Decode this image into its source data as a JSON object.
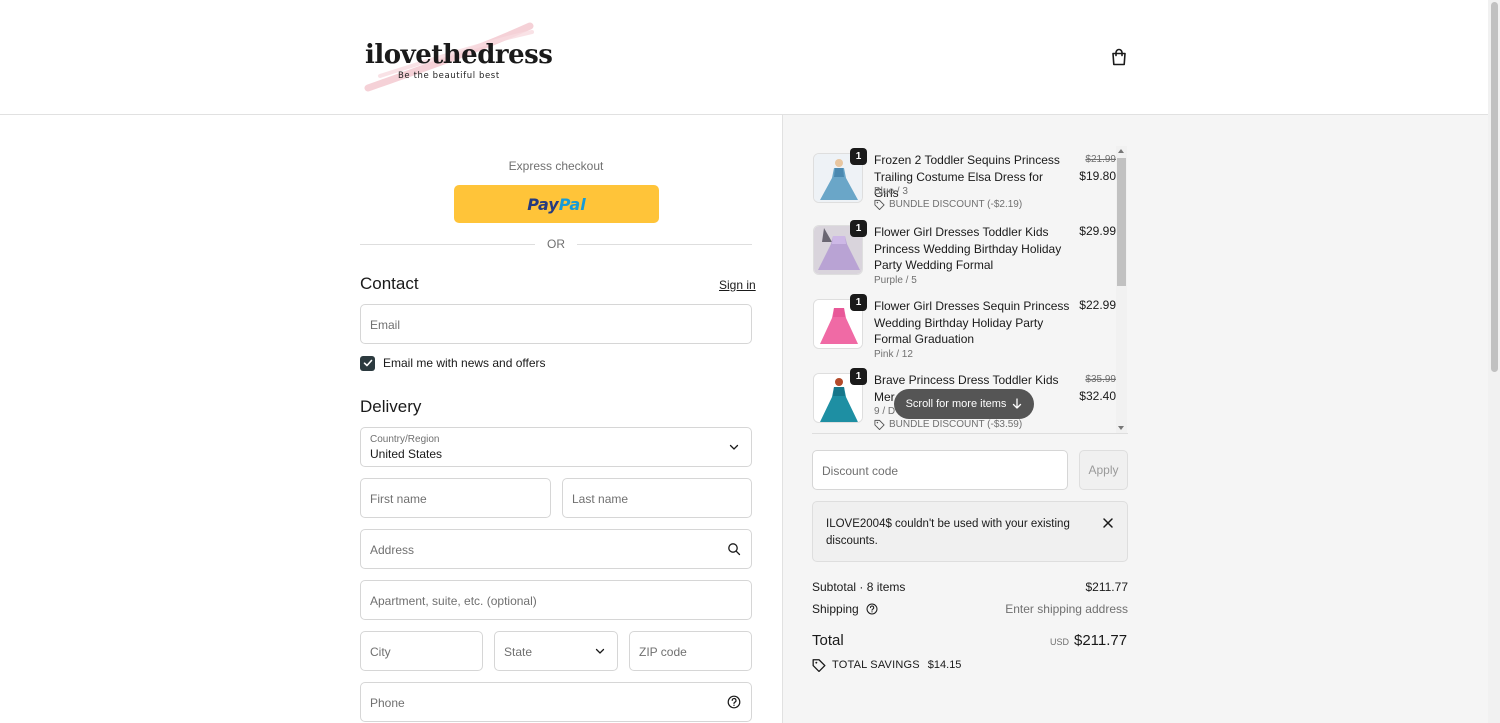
{
  "brand": {
    "name": "ilovethedress",
    "tagline": "Be the beautiful best",
    "accent_stroke": "#f3c9d0"
  },
  "header": {
    "cart_icon": "shopping-bag-icon"
  },
  "express": {
    "label": "Express checkout",
    "paypal_part1": "Pay",
    "paypal_part2": "Pal",
    "or_label": "OR"
  },
  "contact": {
    "title": "Contact",
    "signin_label": "Sign in",
    "email_placeholder": "Email",
    "newsletter_label": "Email me with news and offers",
    "newsletter_checked": true
  },
  "delivery": {
    "title": "Delivery",
    "country_label": "Country/Region",
    "country_value": "United States",
    "first_name_placeholder": "First name",
    "last_name_placeholder": "Last name",
    "address_placeholder": "Address",
    "apartment_placeholder": "Apartment, suite, etc. (optional)",
    "city_placeholder": "City",
    "state_placeholder": "State",
    "zip_placeholder": "ZIP code",
    "phone_placeholder": "Phone"
  },
  "order": {
    "items": [
      {
        "qty": "1",
        "title": "Frozen 2 Toddler Sequins Princess Trailing Costume Elsa Dress for Girls",
        "variant": "Blue / 3",
        "discount": "BUNDLE DISCOUNT (-$2.19)",
        "price_old": "$21.99",
        "price": "$19.80",
        "color": "#6aa6c8"
      },
      {
        "qty": "1",
        "title": "Flower Girl Dresses Toddler Kids Princess Wedding Birthday Holiday Party Wedding Formal",
        "variant": "Purple / 5",
        "discount": "",
        "price_old": "",
        "price": "$29.99",
        "color": "#b9a3d4"
      },
      {
        "qty": "1",
        "title": "Flower Girl Dresses Sequin Princess Wedding Birthday Holiday Party Formal Graduation",
        "variant": "Pink / 12",
        "discount": "",
        "price_old": "",
        "price": "$22.99",
        "color": "#f06aa5"
      },
      {
        "qty": "1",
        "title": "Brave Princess Dress Toddler Kids Merida Costume",
        "title_visible": "Mer",
        "variant": "9 / D",
        "discount": "BUNDLE DISCOUNT (-$3.59)",
        "price_old": "$35.99",
        "price": "$32.40",
        "color": "#1e8fa3"
      }
    ],
    "scroll_hint": "Scroll for more items",
    "discount_placeholder": "Discount code",
    "apply_label": "Apply",
    "notice": "ILOVE2004$ couldn't be used with your existing discounts.",
    "subtotal_label": "Subtotal · 8 items",
    "subtotal_value": "$211.77",
    "shipping_label": "Shipping",
    "shipping_value": "Enter shipping address",
    "total_label": "Total",
    "total_currency": "USD",
    "total_value": "$211.77",
    "savings_label": "TOTAL SAVINGS",
    "savings_value": "$14.15"
  }
}
